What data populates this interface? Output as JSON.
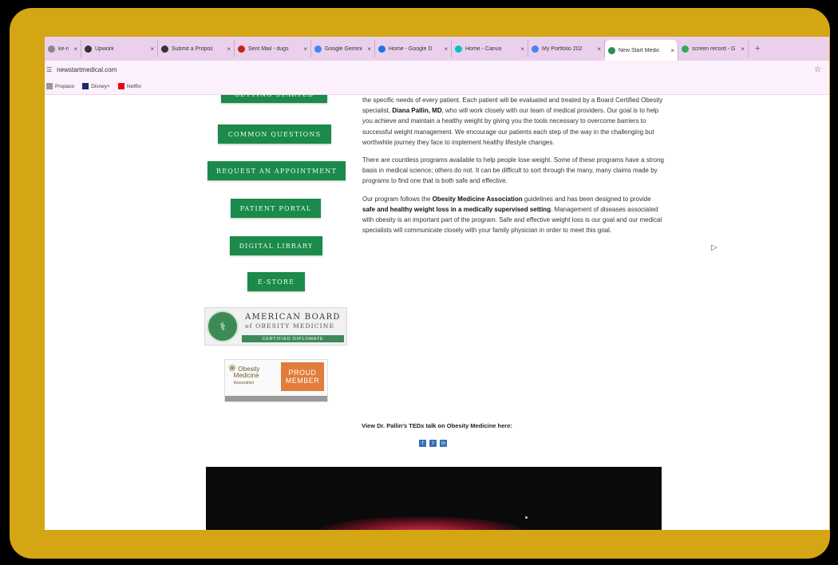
{
  "tabs": [
    {
      "title": "ke-ni",
      "color": "#888888"
    },
    {
      "title": "Upwork",
      "color": "#333333"
    },
    {
      "title": "Submit a Propos",
      "color": "#333333"
    },
    {
      "title": "Sent Mail - dugs",
      "color": "#c5221f"
    },
    {
      "title": "Google Gemini",
      "color": "#4285f4"
    },
    {
      "title": "Home - Google D",
      "color": "#1a73e8"
    },
    {
      "title": "Home - Canva",
      "color": "#00c4cc"
    },
    {
      "title": "My Portfolio 202",
      "color": "#4285f4"
    },
    {
      "title": "New Start Medic",
      "color": "#2e8b57",
      "active": true
    },
    {
      "title": "screen record - G",
      "color": "#34a853"
    }
  ],
  "tab_close": "×",
  "new_tab": "+",
  "address": {
    "url": "newstartmedical.com"
  },
  "bookmarks": [
    {
      "label": "Propaso",
      "color": "#999999"
    },
    {
      "label": "Disney+",
      "color": "#1a2a6c"
    },
    {
      "label": "Netflix",
      "color": "#e50914"
    }
  ],
  "nav": {
    "getting_started": "Getting Started",
    "common_questions": "Common Questions",
    "request_appointment": "Request an Appointment",
    "patient_portal": "Patient Portal",
    "digital_library": "Digital Library",
    "e_store": "E-Store"
  },
  "content": {
    "p1_a": "the specific needs of every patient. Each patient will be evaluated and treated by a Board Certified Obesity specialist, ",
    "p1_b": "Diana Pallin, MD",
    "p1_c": ", who will work closely with our team of medical providers. Our goal is to help you achieve and maintain a healthy weight by giving you the tools necessary to overcome barriers to successful weight management. We encourage our patients each step of the way in the challenging but worthwhile journey they face to implement healthy lifestyle changes.",
    "p2": "There are countless programs available to help people lose weight. Some of these programs have a strong basis in medical science; others do not. It can be difficult to sort through the many, many claims made by programs to find one that is both safe and effective.",
    "p3_a": "Our program follows the ",
    "p3_b": "Obesity Medicine Association",
    "p3_c": " guidelines and has been designed to provide ",
    "p3_d": "safe and healthy weight loss in a medically supervised setting",
    "p3_e": ". Management of diseases associated with obesity is an important part of the program. Safe and effective weight loss is our goal and our medical specialists will communicate closely with your family physician in order to meet this goal."
  },
  "badges": {
    "abom_line1": "AMERICAN BOARD",
    "abom_line2": "of OBESITY MEDICINE",
    "abom_band": "CERTIFIED DIPLOMATE",
    "oma_name1": "Obesity",
    "oma_name2": "Medicine",
    "oma_name3": "Association",
    "oma_proud1": "PROUD",
    "oma_proud2": "MEMBER"
  },
  "tedx_text": "View Dr. Pallin's TEDx talk on Obesity Medicine here:",
  "share_icons": [
    "f",
    "t",
    "in"
  ],
  "colors": {
    "nav_green": "#1b8a4b",
    "frame_gold": "#d4a514"
  }
}
